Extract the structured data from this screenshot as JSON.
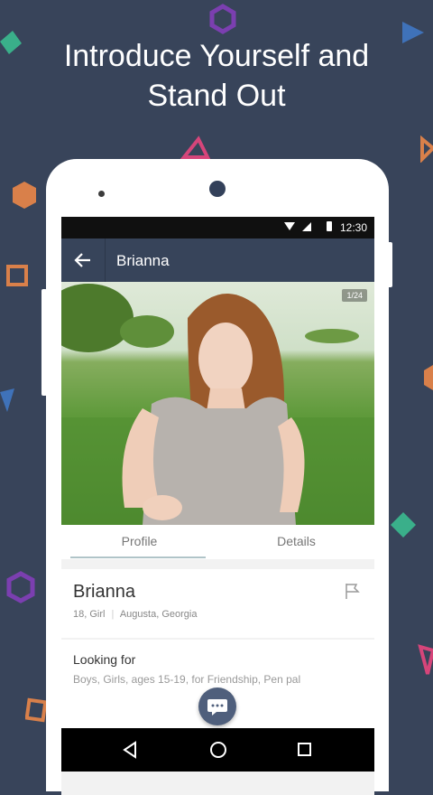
{
  "promo": {
    "headline_line1": "Introduce Yourself and",
    "headline_line2": "Stand Out"
  },
  "colors": {
    "background": "#38445a",
    "app_bar": "#37445a",
    "decor_purple": "#7b3fb0",
    "decor_blue": "#3f72b9",
    "decor_orange": "#d9804a",
    "decor_green": "#3aaf8a",
    "decor_pink": "#d6457a"
  },
  "status_bar": {
    "time": "12:30"
  },
  "app_bar": {
    "title": "Brianna",
    "back_icon": "arrow-left-icon"
  },
  "photo": {
    "counter": "1/24"
  },
  "tabs": [
    {
      "label": "Profile",
      "active": true
    },
    {
      "label": "Details",
      "active": false
    }
  ],
  "profile": {
    "name": "Brianna",
    "age_gender": "18, Girl",
    "location": "Augusta, Georgia",
    "flag_icon": "flag-icon"
  },
  "looking_for": {
    "title": "Looking for",
    "value": "Boys, Girls, ages 15-19, for Friendship, Pen pal"
  },
  "fab": {
    "icon": "chat-bubble-icon"
  },
  "nav": {
    "back_icon": "nav-back-icon",
    "home_icon": "nav-home-icon",
    "recent_icon": "nav-recent-icon"
  }
}
